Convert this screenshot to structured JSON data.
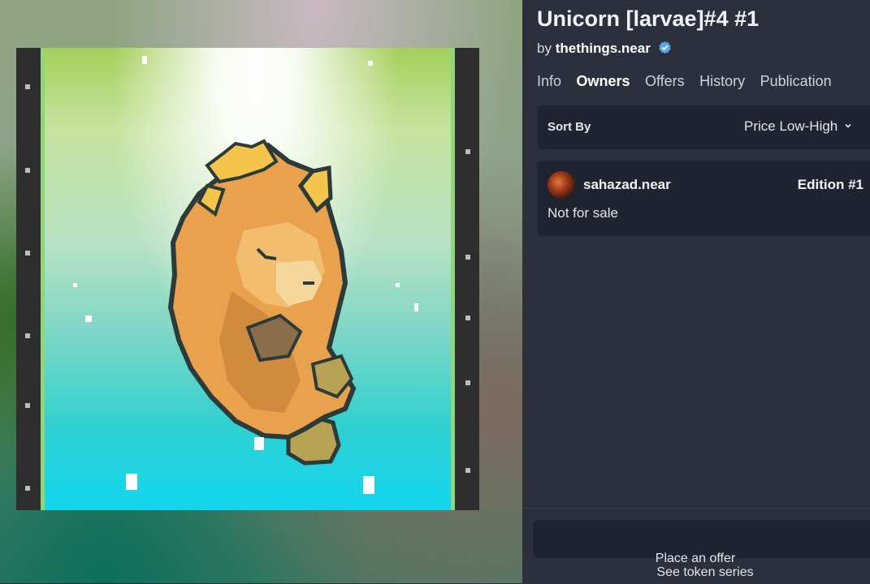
{
  "title": "Unicorn [larvae]#4 #1",
  "byline": {
    "prefix": "by",
    "creator": "thethings.near",
    "verified_icon": "verified-badge-icon"
  },
  "tabs": [
    {
      "label": "Info",
      "active": false
    },
    {
      "label": "Owners",
      "active": true
    },
    {
      "label": "Offers",
      "active": false
    },
    {
      "label": "History",
      "active": false
    },
    {
      "label": "Publication",
      "active": false
    }
  ],
  "sort": {
    "label": "Sort By",
    "value": "Price Low-High",
    "icon": "chevron-down-icon"
  },
  "owner_card": {
    "name": "sahazad.near",
    "edition": "Edition #1",
    "status": "Not for sale"
  },
  "actions": {
    "place_offer": "Place an offer",
    "see_series": "See token series"
  },
  "colors": {
    "panel_bg": "#2b303c",
    "card_bg": "#1f2430",
    "accent_verified": "#5aa7e8"
  }
}
